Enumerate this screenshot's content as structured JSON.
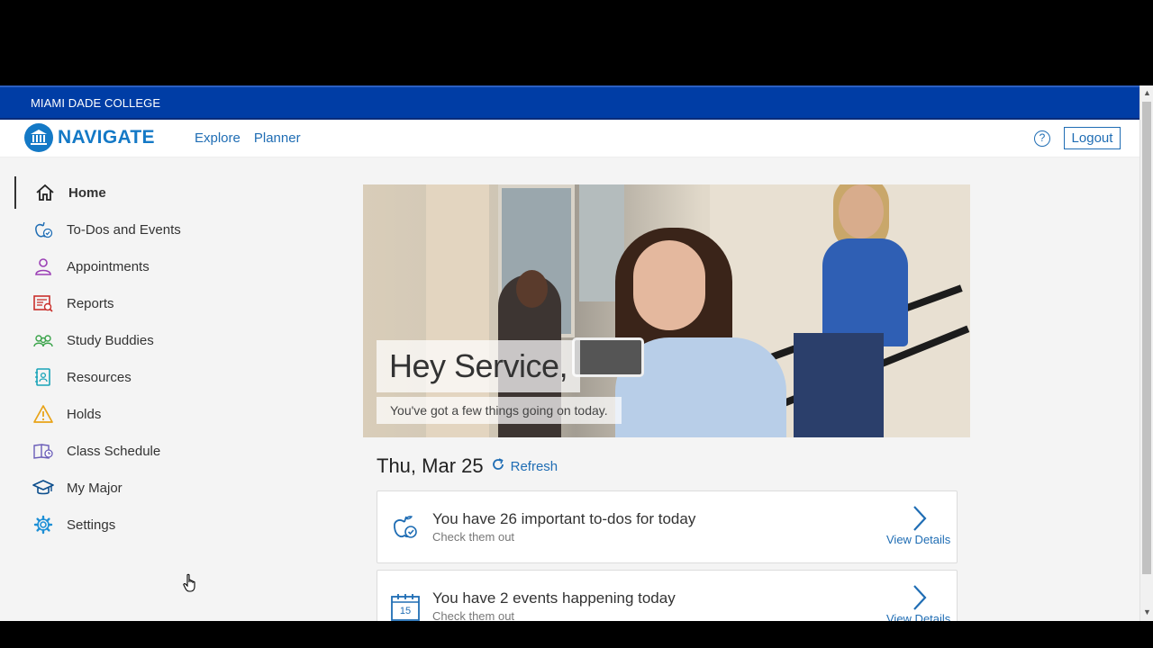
{
  "header": {
    "college": "MIAMI DADE COLLEGE"
  },
  "nav": {
    "logo_text": "NAVIGATE",
    "links": [
      "Explore",
      "Planner"
    ],
    "help_icon": "question-circle-icon",
    "logout_label": "Logout"
  },
  "sidebar": {
    "items": [
      {
        "label": "Home",
        "icon": "home-icon",
        "active": true
      },
      {
        "label": "To-Dos and Events",
        "icon": "apple-check-icon"
      },
      {
        "label": "Appointments",
        "icon": "person-icon"
      },
      {
        "label": "Reports",
        "icon": "report-icon"
      },
      {
        "label": "Study Buddies",
        "icon": "people-icon"
      },
      {
        "label": "Resources",
        "icon": "notebook-icon"
      },
      {
        "label": "Holds",
        "icon": "warning-icon"
      },
      {
        "label": "Class Schedule",
        "icon": "book-icon"
      },
      {
        "label": "My Major",
        "icon": "graduation-cap-icon"
      },
      {
        "label": "Settings",
        "icon": "gear-icon"
      }
    ]
  },
  "hero": {
    "greeting": "Hey Service,",
    "subtitle": "You've got a few things going on today."
  },
  "today": {
    "date": "Thu, Mar 25",
    "refresh_label": "Refresh"
  },
  "cards": [
    {
      "title": "You have 26 important to-dos for today",
      "sub": "Check them out",
      "link": "View Details",
      "icon": "apple-check-icon"
    },
    {
      "title": "You have 2 events happening today",
      "sub": "Check them out",
      "link": "View Details",
      "icon": "calendar-icon",
      "calendar_day": "15"
    }
  ],
  "colors": {
    "brand_blue": "#003da5",
    "link_blue": "#1f6db4",
    "logo_blue": "#1479c6"
  }
}
